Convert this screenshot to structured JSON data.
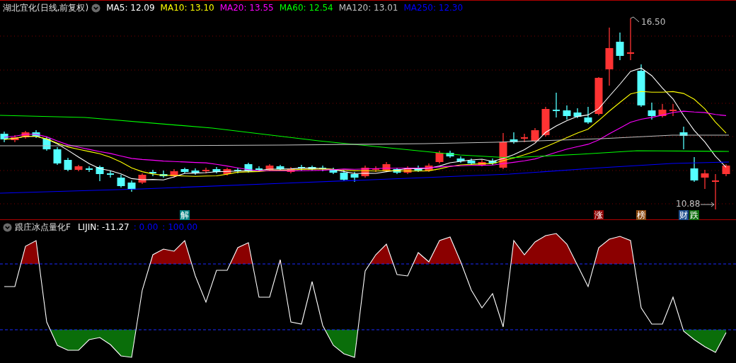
{
  "main_chart": {
    "title": "湖北宜化(日线,前复权)",
    "legend": [
      {
        "label": "MA5: 12.09",
        "color": "#ffffff"
      },
      {
        "label": "MA10: 13.10",
        "color": "#ffff00"
      },
      {
        "label": "MA20: 13.55",
        "color": "#ff00ff"
      },
      {
        "label": "MA60: 12.54",
        "color": "#00ff00"
      },
      {
        "label": "MA120: 13.01",
        "color": "#c0c0c0"
      },
      {
        "label": "MA250: 12.30",
        "color": "#0000ff"
      }
    ],
    "high_label": "16.50",
    "low_label": "10.88",
    "markers": [
      {
        "label": "解",
        "color": "#008080"
      },
      {
        "label": "涨",
        "color": "#8b0000"
      },
      {
        "label": "榜",
        "color": "#8b4a10"
      },
      {
        "label": "财",
        "color": "#1e4e8c"
      },
      {
        "label": "跌",
        "color": "#107010"
      }
    ]
  },
  "indicator": {
    "title": "跟庄冰点量化F",
    "values": [
      {
        "label": "LIJIN: -11.27",
        "color": "#ffffff"
      },
      {
        "label": ": 0.00",
        "color": "#0000ff"
      },
      {
        "label": ": 100.00",
        "color": "#0000ff"
      }
    ]
  }
}
